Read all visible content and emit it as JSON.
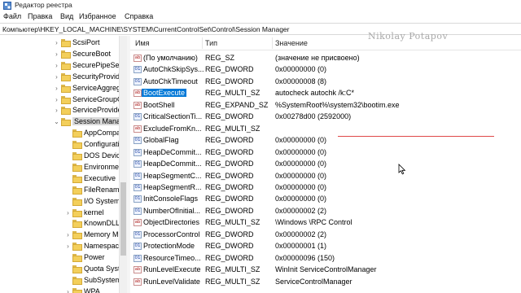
{
  "window": {
    "title": "Редактор реестра"
  },
  "menu": [
    "Файл",
    "Правка",
    "Вид",
    "Избранное",
    "Справка"
  ],
  "address": "Компьютер\\HKEY_LOCAL_MACHINE\\SYSTEM\\CurrentControlSet\\Control\\Session Manager",
  "watermark": "Nikolay Potapov",
  "columns": {
    "name": "Имя",
    "type": "Тип",
    "value": "Значение"
  },
  "tree": [
    {
      "label": "ScsiPort",
      "level": 1,
      "expander": "›"
    },
    {
      "label": "SecureBoot",
      "level": 1,
      "expander": "›"
    },
    {
      "label": "SecurePipeSer",
      "level": 1,
      "expander": "›"
    },
    {
      "label": "SecurityProvid",
      "level": 1,
      "expander": "›"
    },
    {
      "label": "ServiceAggreg",
      "level": 1,
      "expander": "›"
    },
    {
      "label": "ServiceGroupO",
      "level": 1,
      "expander": "›"
    },
    {
      "label": "ServiceProvide",
      "level": 1,
      "expander": "›"
    },
    {
      "label": "Session Manag",
      "level": 1,
      "expander": "⌄",
      "selected": true
    },
    {
      "label": "AppCompa",
      "level": 2,
      "expander": ""
    },
    {
      "label": "Configurati",
      "level": 2,
      "expander": ""
    },
    {
      "label": "DOS Device",
      "level": 2,
      "expander": ""
    },
    {
      "label": "Environmer",
      "level": 2,
      "expander": ""
    },
    {
      "label": "Executive",
      "level": 2,
      "expander": ""
    },
    {
      "label": "FileRename",
      "level": 2,
      "expander": ""
    },
    {
      "label": "I/O System",
      "level": 2,
      "expander": ""
    },
    {
      "label": "kernel",
      "level": 2,
      "expander": "›"
    },
    {
      "label": "KnownDLLs",
      "level": 2,
      "expander": ""
    },
    {
      "label": "Memory M",
      "level": 2,
      "expander": "›"
    },
    {
      "label": "Namespace",
      "level": 2,
      "expander": "›"
    },
    {
      "label": "Power",
      "level": 2,
      "expander": ""
    },
    {
      "label": "Quota Syst",
      "level": 2,
      "expander": ""
    },
    {
      "label": "SubSystem",
      "level": 2,
      "expander": ""
    },
    {
      "label": "WPA",
      "level": 2,
      "expander": "›"
    }
  ],
  "values": [
    {
      "name": "(По умолчанию)",
      "type": "REG_SZ",
      "data": "(значение не присвоено)",
      "kind": "sz"
    },
    {
      "name": "AutoChkSkipSys...",
      "type": "REG_DWORD",
      "data": "0x00000000 (0)",
      "kind": "bin"
    },
    {
      "name": "AutoChkTimeout",
      "type": "REG_DWORD",
      "data": "0x00000008 (8)",
      "kind": "bin"
    },
    {
      "name": "BootExecute",
      "type": "REG_MULTI_SZ",
      "data": "autocheck autochk /k:C*",
      "kind": "sz",
      "selected": true
    },
    {
      "name": "BootShell",
      "type": "REG_EXPAND_SZ",
      "data": "%SystemRoot%\\system32\\bootim.exe",
      "kind": "sz"
    },
    {
      "name": "CriticalSectionTi...",
      "type": "REG_DWORD",
      "data": "0x00278d00 (2592000)",
      "kind": "bin"
    },
    {
      "name": "ExcludeFromKn...",
      "type": "REG_MULTI_SZ",
      "data": "",
      "kind": "sz"
    },
    {
      "name": "GlobalFlag",
      "type": "REG_DWORD",
      "data": "0x00000000 (0)",
      "kind": "bin"
    },
    {
      "name": "HeapDeCommit...",
      "type": "REG_DWORD",
      "data": "0x00000000 (0)",
      "kind": "bin"
    },
    {
      "name": "HeapDeCommit...",
      "type": "REG_DWORD",
      "data": "0x00000000 (0)",
      "kind": "bin"
    },
    {
      "name": "HeapSegmentC...",
      "type": "REG_DWORD",
      "data": "0x00000000 (0)",
      "kind": "bin"
    },
    {
      "name": "HeapSegmentR...",
      "type": "REG_DWORD",
      "data": "0x00000000 (0)",
      "kind": "bin"
    },
    {
      "name": "InitConsoleFlags",
      "type": "REG_DWORD",
      "data": "0x00000000 (0)",
      "kind": "bin"
    },
    {
      "name": "NumberOfInitial...",
      "type": "REG_DWORD",
      "data": "0x00000002 (2)",
      "kind": "bin"
    },
    {
      "name": "ObjectDirectories",
      "type": "REG_MULTI_SZ",
      "data": "\\Windows \\RPC Control",
      "kind": "sz"
    },
    {
      "name": "ProcessorControl",
      "type": "REG_DWORD",
      "data": "0x00000002 (2)",
      "kind": "bin"
    },
    {
      "name": "ProtectionMode",
      "type": "REG_DWORD",
      "data": "0x00000001 (1)",
      "kind": "bin"
    },
    {
      "name": "ResourceTimeo...",
      "type": "REG_DWORD",
      "data": "0x00000096 (150)",
      "kind": "bin"
    },
    {
      "name": "RunLevelExecute",
      "type": "REG_MULTI_SZ",
      "data": "WinInit ServiceControlManager",
      "kind": "sz"
    },
    {
      "name": "RunLevelValidate",
      "type": "REG_MULTI_SZ",
      "data": "ServiceControlManager",
      "kind": "sz"
    }
  ]
}
